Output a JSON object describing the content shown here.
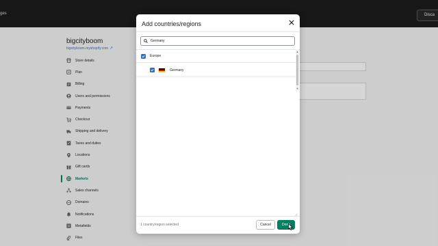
{
  "topbar": {
    "left_fragment": "ges",
    "discard_label": "Disca"
  },
  "store": {
    "name": "bigcityboom",
    "url": "bigcityboom.myshopify.com"
  },
  "sidebar": {
    "items": [
      {
        "label": "Store details",
        "icon": "store-icon"
      },
      {
        "label": "Plan",
        "icon": "plan-icon"
      },
      {
        "label": "Billing",
        "icon": "billing-icon"
      },
      {
        "label": "Users and permissions",
        "icon": "user-icon"
      },
      {
        "label": "Payments",
        "icon": "payments-icon"
      },
      {
        "label": "Checkout",
        "icon": "cart-icon"
      },
      {
        "label": "Shipping and delivery",
        "icon": "truck-icon"
      },
      {
        "label": "Taxes and duties",
        "icon": "taxes-icon"
      },
      {
        "label": "Locations",
        "icon": "location-icon"
      },
      {
        "label": "Gift cards",
        "icon": "gift-icon"
      },
      {
        "label": "Markets",
        "icon": "globe-icon",
        "active": true
      },
      {
        "label": "Sales channels",
        "icon": "channels-icon"
      },
      {
        "label": "Domains",
        "icon": "domain-icon"
      },
      {
        "label": "Notifications",
        "icon": "bell-icon"
      },
      {
        "label": "Metafields",
        "icon": "metafields-icon"
      },
      {
        "label": "Files",
        "icon": "files-icon"
      }
    ]
  },
  "modal": {
    "title": "Add countries/regions",
    "search": {
      "value": "Germany"
    },
    "region": {
      "label": "Europe",
      "checked": true
    },
    "countries": [
      {
        "label": "Germany",
        "checked": true,
        "flag_colors": [
          "#000000",
          "#dd0000",
          "#ffce00"
        ]
      }
    ],
    "footer_text": "1 country/region selected",
    "cancel_label": "Cancel",
    "done_label": "Done"
  },
  "colors": {
    "primary": "#008060",
    "checkbox": "#2c6ecb",
    "topbar": "#1a1a1a"
  }
}
